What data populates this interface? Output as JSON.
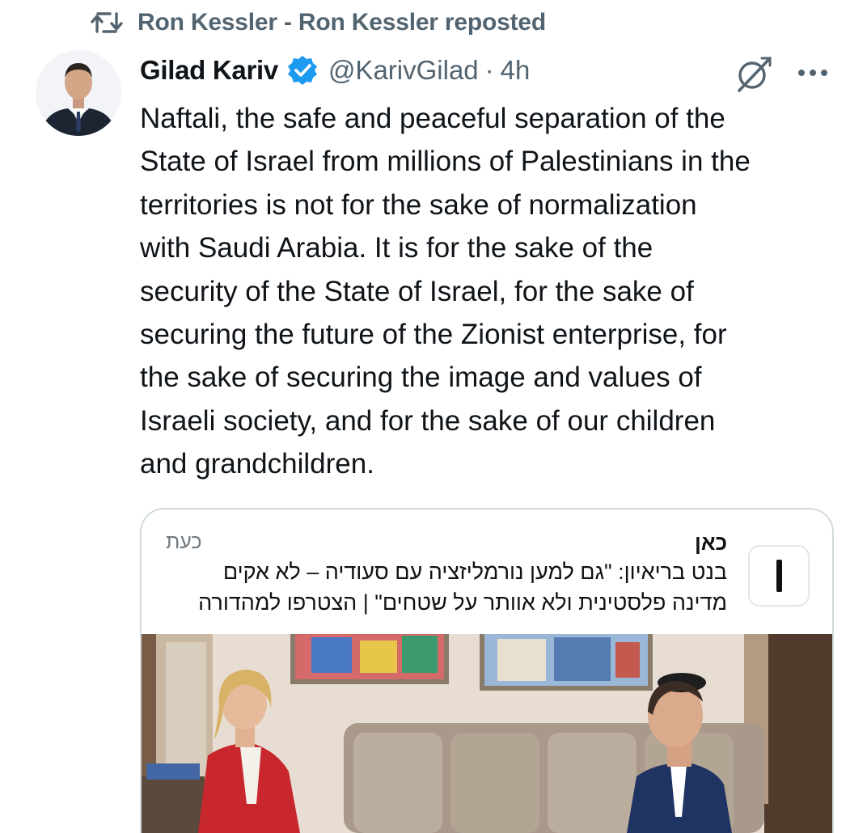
{
  "repost": {
    "icon": "repost-icon",
    "text": "Ron Kessler - Ron Kessler reposted"
  },
  "tweet": {
    "author_name": "Gilad Kariv",
    "verified_icon": "verified-badge-icon",
    "handle": "@KarivGilad",
    "separator": "·",
    "time": "4h",
    "text": "Naftali, the safe and peaceful separation of the\nState of Israel from millions of Palestinians in the\nterritories is not for the sake of normalization\nwith Saudi Arabia. It is for the sake of the\nsecurity of the State of Israel, for the sake of\nsecuring the future of the Zionist enterprise, for\nthe sake of securing the image and values of\nIsraeli society, and for the sake of our children\nand grandchildren."
  },
  "actions": {
    "grok_icon": "grok-icon",
    "more_icon": "more-options-icon"
  },
  "card": {
    "source_name": "כאן",
    "time": "כעת",
    "headline": "בנט בריאיון: \"גם למען נורמליזציה עם סעודיה – לא אקים מדינה פלסטינית ולא אוותר על שטחים\" | הצטרפו למהדורה"
  },
  "colors": {
    "text": "#0f1419",
    "muted": "#536471",
    "verified": "#1d9bf0",
    "border": "#cfd9de"
  }
}
